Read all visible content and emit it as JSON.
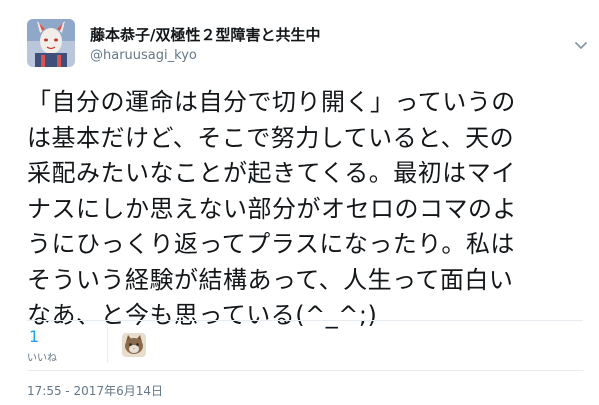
{
  "author": {
    "display_name": "藤本恭子/双極性２型障害と共生中",
    "handle": "@haruusagi_kyo",
    "avatar_icon": "user-avatar-icon"
  },
  "tweet": {
    "lines": [
      "「自分の運命は自分で切り開く」っていうの",
      "は基本だけど、そこで努力していると、天の",
      "采配みたいなことが起きてくる。最初はマイ",
      "ナスにしか思えない部分がオセロのコマのよ",
      "うにひっくり返ってプラスになったり。私は",
      "そういう経験が結構あって、人生って面白い",
      "なあ、と今も思っている(^_^;)"
    ],
    "timestamp": "17:55 - 2017年6月14日"
  },
  "engagement": {
    "likes_count": "1",
    "likes_label": "いいね",
    "liker_avatar_icon": "cat-avatar-icon"
  },
  "menu": {
    "caret_icon": "chevron-down-icon"
  },
  "colors": {
    "accent": "#1da1f2",
    "text": "#14171a",
    "secondary": "#657786",
    "divider": "#e6ecf0"
  }
}
